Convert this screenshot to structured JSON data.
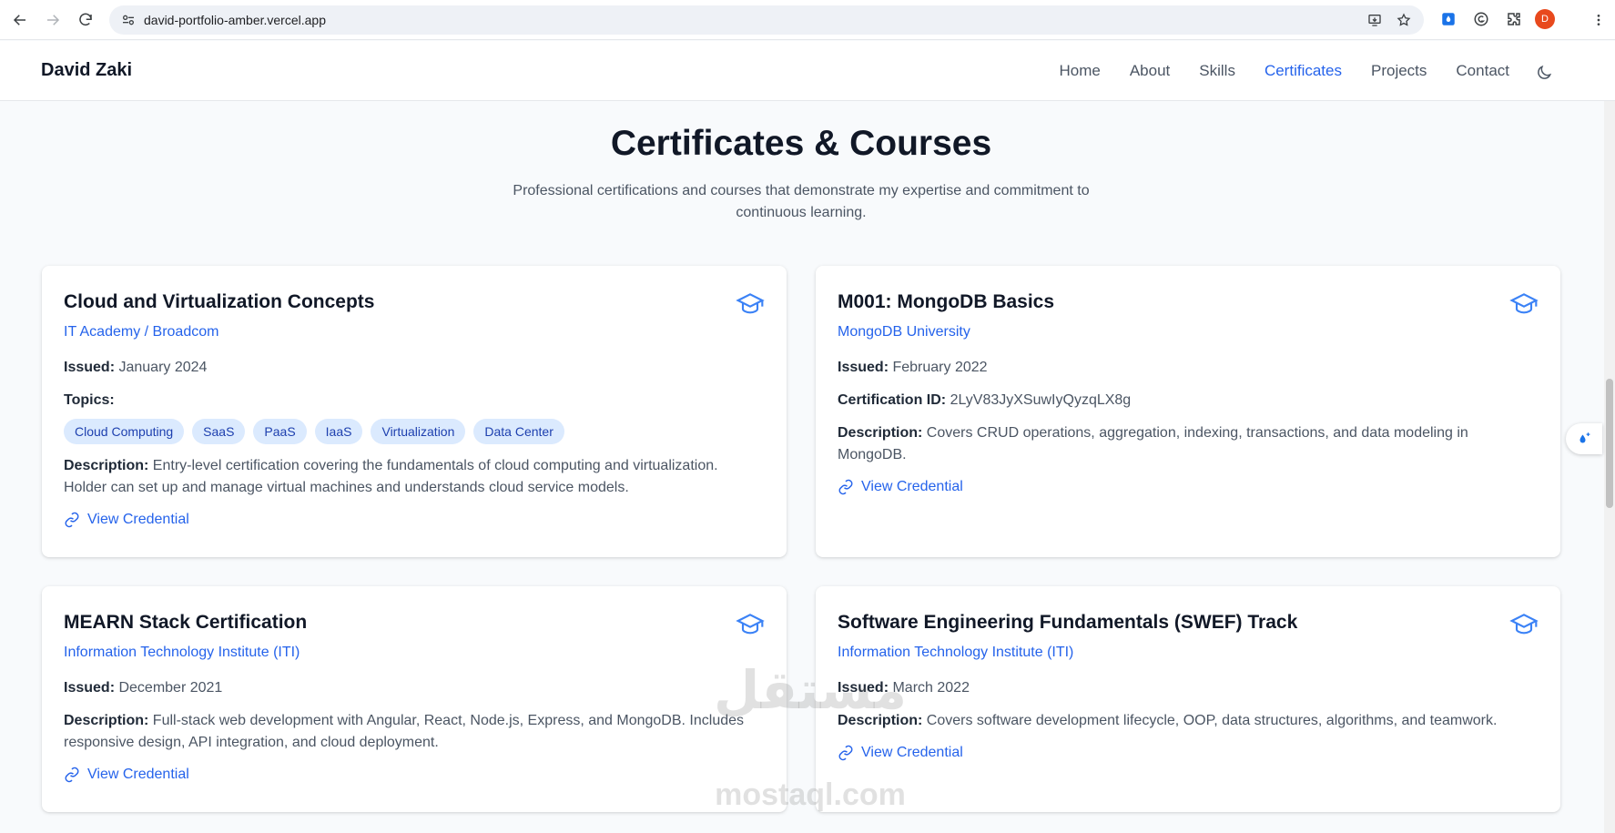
{
  "browser": {
    "url": "david-portfolio-amber.vercel.app",
    "profile_initial": "D"
  },
  "header": {
    "brand": "David Zaki",
    "nav": [
      {
        "label": "Home"
      },
      {
        "label": "About"
      },
      {
        "label": "Skills"
      },
      {
        "label": "Certificates"
      },
      {
        "label": "Projects"
      },
      {
        "label": "Contact"
      }
    ],
    "active_nav": "Certificates"
  },
  "section": {
    "title": "Certificates & Courses",
    "subtitle": "Professional certifications and courses that demonstrate my expertise and commitment to continuous learning."
  },
  "labels": {
    "issued": "Issued:",
    "topics": "Topics:",
    "description": "Description:",
    "certification_id": "Certification ID:",
    "view_credential": "View Credential"
  },
  "certificates": [
    {
      "title": "Cloud and Virtualization Concepts",
      "issuer": "IT Academy / Broadcom",
      "issued": "January 2024",
      "topics": [
        "Cloud Computing",
        "SaaS",
        "PaaS",
        "IaaS",
        "Virtualization",
        "Data Center"
      ],
      "description": "Entry-level certification covering the fundamentals of cloud computing and virtualization. Holder can set up and manage virtual machines and understands cloud service models."
    },
    {
      "title": "M001: MongoDB Basics",
      "issuer": "MongoDB University",
      "issued": "February 2022",
      "certification_id": "2LyV83JyXSuwIyQyzqLX8g",
      "description": "Covers CRUD operations, aggregation, indexing, transactions, and data modeling in MongoDB."
    },
    {
      "title": "MEARN Stack Certification",
      "issuer": "Information Technology Institute (ITI)",
      "issued": "December 2021",
      "description": "Full-stack web development with Angular, React, Node.js, Express, and MongoDB. Includes responsive design, API integration, and cloud deployment."
    },
    {
      "title": "Software Engineering Fundamentals (SWEF) Track",
      "issuer": "Information Technology Institute (ITI)",
      "issued": "March 2022",
      "description": "Covers software development lifecycle, OOP, data structures, algorithms, and teamwork."
    }
  ],
  "icons": {
    "card_icon": "graduation-cap-icon",
    "credential_icon": "link-icon",
    "theme_icon": "moon-icon"
  },
  "colors": {
    "accent": "#2563eb",
    "chip_bg": "#dbeafe",
    "chip_text": "#1e40af"
  },
  "watermark": {
    "arabic": "مستقل",
    "latin": "mostaql.com"
  }
}
